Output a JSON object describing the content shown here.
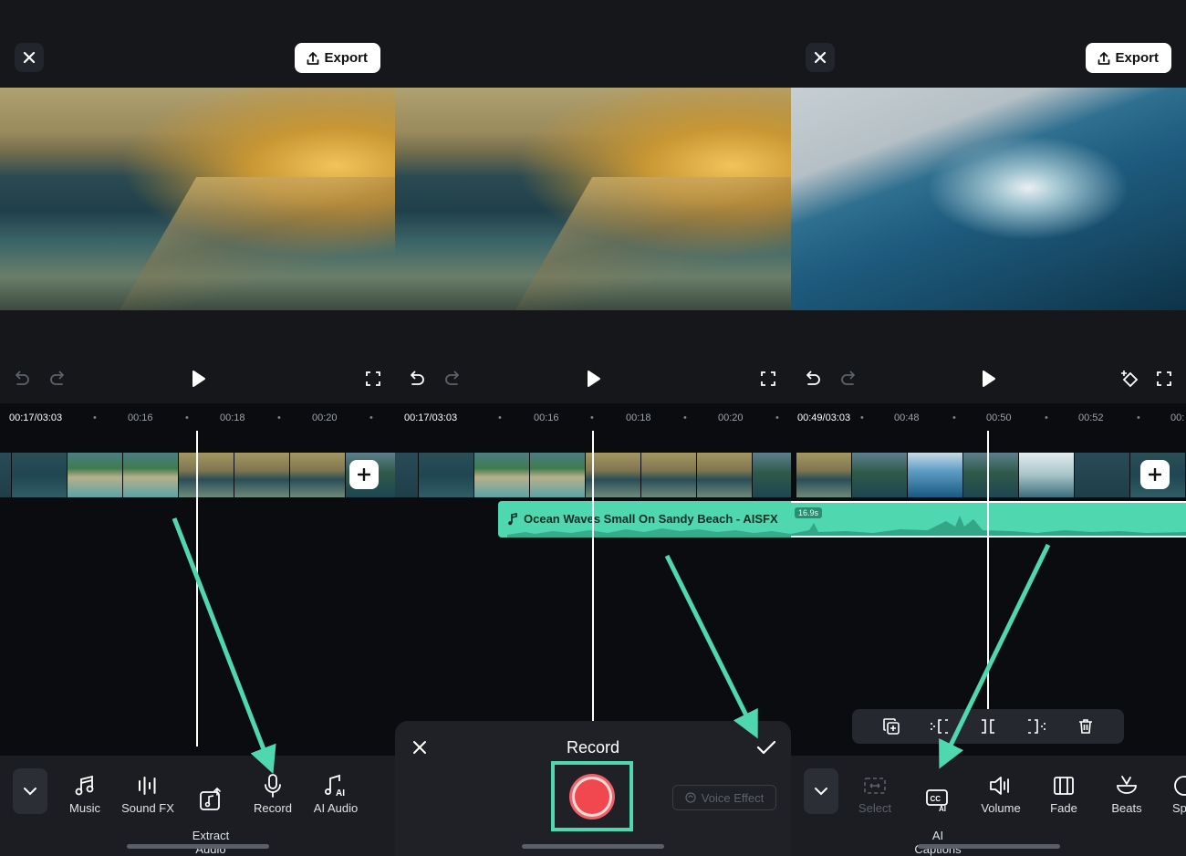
{
  "panels": [
    {
      "id": "editor-music",
      "export_label": "Export",
      "ruler": [
        "00:17/03:03",
        "00:16",
        "00:18",
        "00:20"
      ],
      "tools": [
        {
          "label": "Music",
          "icon": "music-note-icon"
        },
        {
          "label": "Sound FX",
          "icon": "sound-bars-icon"
        },
        {
          "label": "Extract\nAudio",
          "icon": "extract-audio-icon"
        },
        {
          "label": "Record",
          "icon": "microphone-icon"
        },
        {
          "label": "AI Audio",
          "icon": "ai-audio-icon"
        }
      ]
    },
    {
      "id": "editor-record",
      "ruler": [
        "00:17/03:03",
        "00:16",
        "00:18",
        "00:20"
      ],
      "audio_clip": "Ocean Waves Small On Sandy Beach - AISFX",
      "sheet_title": "Record",
      "voice_effect": "Voice Effect"
    },
    {
      "id": "editor-audio-edit",
      "export_label": "Export",
      "ruler": [
        "00:49/03:03",
        "00:48",
        "00:50",
        "00:52",
        "00:"
      ],
      "audio_duration": "16.9s",
      "tools": [
        {
          "label": "Select",
          "icon": "select-icon",
          "disabled": true
        },
        {
          "label": "AI\nCaptions",
          "icon": "ai-captions-icon"
        },
        {
          "label": "Volume",
          "icon": "volume-icon"
        },
        {
          "label": "Fade",
          "icon": "fade-icon"
        },
        {
          "label": "Beats",
          "icon": "beats-icon"
        },
        {
          "label": "Sp",
          "icon": "speed-icon"
        }
      ]
    }
  ],
  "colors": {
    "accent": "#4fd8b0",
    "record": "#f0484e",
    "background": "#15171b"
  }
}
